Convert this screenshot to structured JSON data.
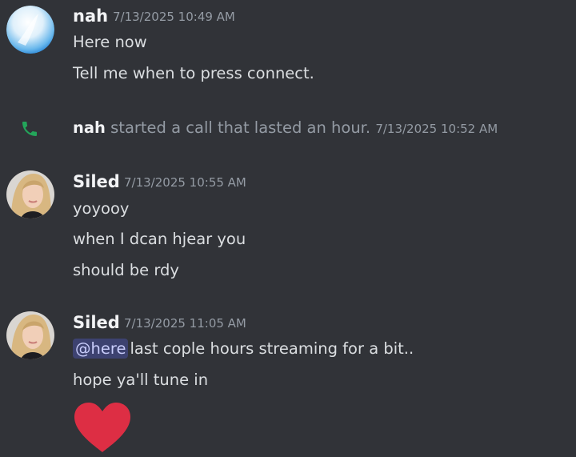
{
  "messages": [
    {
      "author": "nah",
      "timestamp": "7/13/2025 10:49 AM",
      "lines": [
        "Here now",
        "Tell me when to press connect."
      ]
    },
    {
      "system": {
        "icon": "phone-icon",
        "author": "nah",
        "text": "started a call that lasted an hour.",
        "timestamp": "7/13/2025 10:52 AM"
      }
    },
    {
      "author": "Siled",
      "timestamp": "7/13/2025 10:55 AM",
      "lines": [
        "yoyooy",
        "when I dcan hjear you",
        "should be rdy"
      ]
    },
    {
      "author": "Siled",
      "timestamp": "7/13/2025 11:05 AM",
      "mention": "@here",
      "lines": [
        "last cople hours streaming for a bit..",
        "hope ya'll tune in"
      ],
      "emoji": "red-heart"
    }
  ],
  "colors": {
    "background": "#313338",
    "call_icon": "#23a55a",
    "mention_bg": "#3d4270",
    "heart": "#dd2e44"
  }
}
